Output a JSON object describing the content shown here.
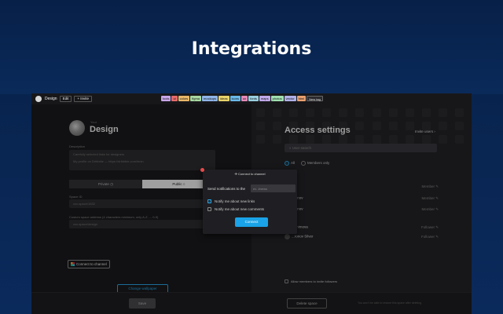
{
  "hero": {
    "title": "Integrations"
  },
  "topbar": {
    "title": "Design",
    "edit_label": "Edit",
    "invite_label": "+ Invite",
    "tags": [
      {
        "label": "tools",
        "color": "#c9a6e8"
      },
      {
        "label": "ui",
        "color": "#e66b6b"
      },
      {
        "label": "colors",
        "color": "#e8b76a"
      },
      {
        "label": "figma",
        "color": "#a8d8a0"
      },
      {
        "label": "mockups",
        "color": "#8fb5e8"
      },
      {
        "label": "ideas",
        "color": "#e8d36a"
      },
      {
        "label": "icons",
        "color": "#6ab8e8"
      },
      {
        "label": "ux",
        "color": "#e88ab8"
      },
      {
        "label": "fonts",
        "color": "#9ad0e0"
      },
      {
        "label": "maps",
        "color": "#c0a8e8"
      },
      {
        "label": "photos",
        "color": "#a0e0b0"
      },
      {
        "label": "vector",
        "color": "#b0b0e8"
      },
      {
        "label": "html",
        "color": "#e8a070"
      },
      {
        "label": "New tag",
        "color": "#2a2a2e"
      }
    ]
  },
  "space": {
    "label": "Your",
    "name": "Design",
    "description_label": "Description",
    "description_line1": "Carefully selected links for designers",
    "description_line2": "My profile on Dribbble — https://dribbble.com/lenin",
    "private_label": "Private",
    "public_label": "Public",
    "id_label": "Space ID",
    "id_value": "xxx-space/1832",
    "address_label": "Custom space address (4 characters minimum, only A-Z, ... 0-9)",
    "address_value": "xxx-space/design",
    "slack_label": "Connect to channel",
    "wallpaper_label": "Change wallpaper",
    "save_label": "Save"
  },
  "access": {
    "title": "Access settings",
    "invite_label": "Invite users",
    "search_placeholder": "User search",
    "radio_all": "All",
    "radio_members": "Members only",
    "users": [
      {
        "name": "...",
        "role": "Member"
      },
      {
        "name": "...dinov",
        "role": "Member"
      },
      {
        "name": "...dinov",
        "role": "Member"
      },
      {
        "name": "...animova",
        "role": "Follower"
      },
      {
        "name": "...ronov Silver",
        "role": "Follower"
      }
    ],
    "allow_label": "Allow members to invite followers",
    "delete_label": "Delete space",
    "warning": "You won't be able to restore this space after deleting."
  },
  "modal": {
    "title": "Connect to channel",
    "send_label": "Send notifications to the",
    "channel_placeholder": "ex. #news",
    "check_links": "Notify me about new links",
    "check_comments": "Notify me about new comments",
    "connect_label": "Connect"
  }
}
